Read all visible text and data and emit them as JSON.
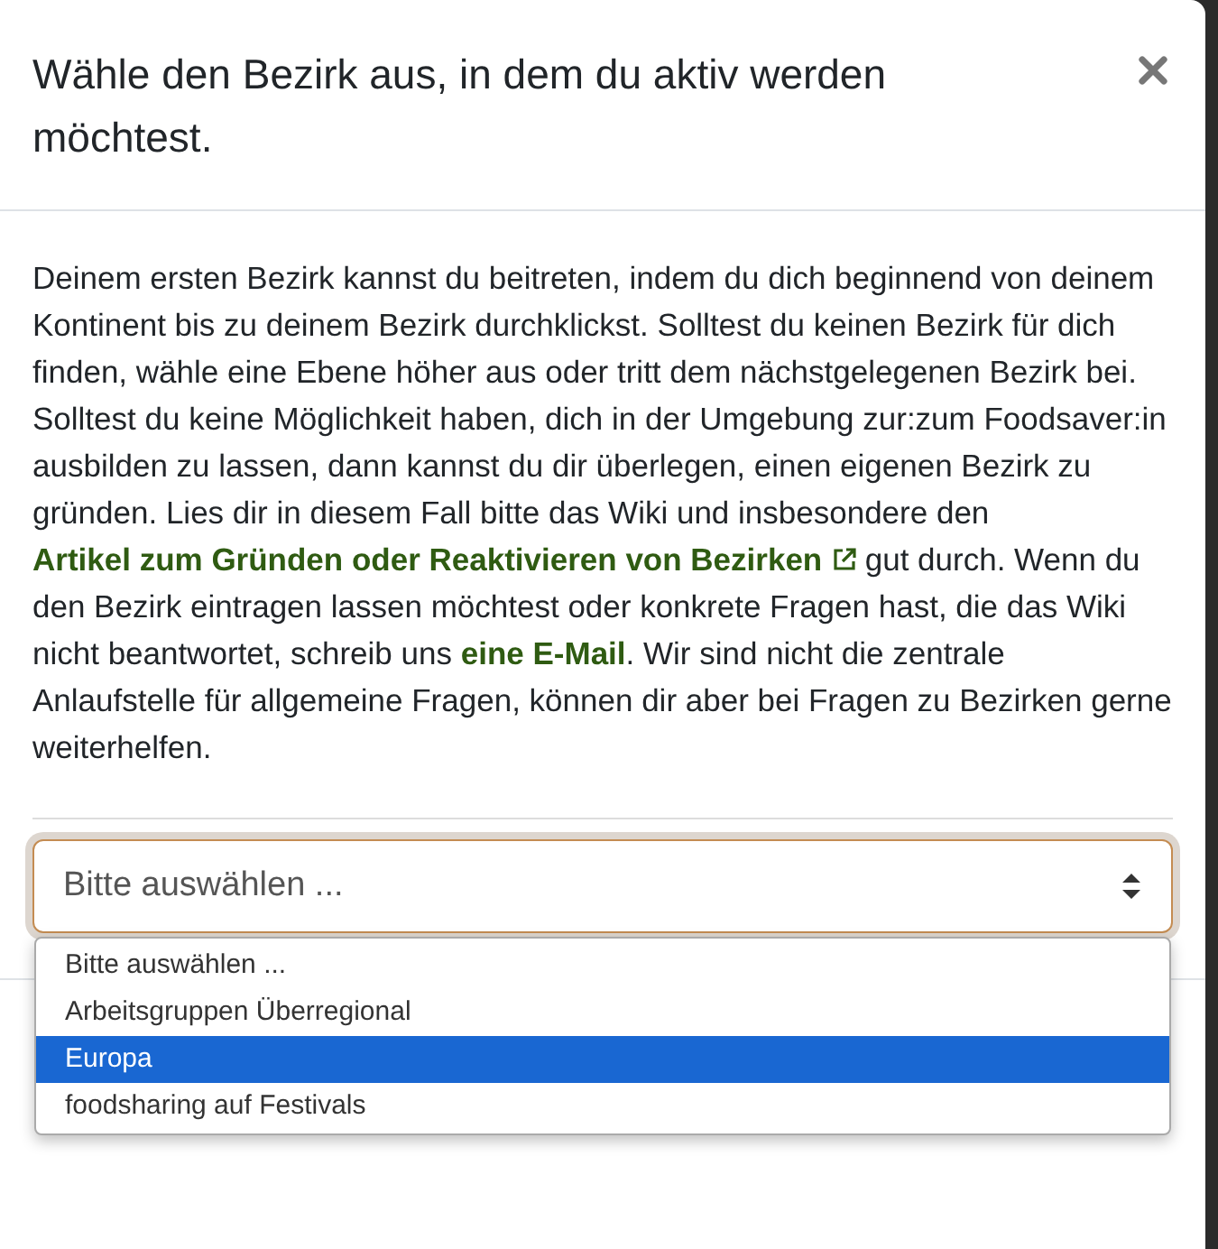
{
  "dialog": {
    "title": "Wähle den Bezirk aus, in dem du aktiv werden möchtest."
  },
  "description": [
    {
      "kind": "text",
      "text": "Deinem ersten Bezirk kannst du beitreten, indem du dich beginnend von deinem Kontinent bis zu deinem Bezirk durchklickst. Solltest du keinen Bezirk für dich finden, wähle eine Ebene höher aus oder tritt dem nächstgelegenen Bezirk bei. Solltest du keine Möglichkeit haben, dich in der Umgebung zur:zum Foodsaver:in ausbilden zu lassen, dann kannst du dir überlegen, einen eigenen Bezirk zu gründen. Lies dir in diesem Fall bitte das Wiki und insbesondere den "
    },
    {
      "kind": "link",
      "text": "Artikel zum Gründen oder Reaktivieren von Bezirken",
      "external": true
    },
    {
      "kind": "text",
      "text": " gut durch. Wenn du den Bezirk eintragen lassen möchtest oder konkrete Fragen hast, die das Wiki nicht beantwortet, schreib uns "
    },
    {
      "kind": "link",
      "text": "eine E-Mail",
      "external": false
    },
    {
      "kind": "text",
      "text": ". Wir sind nicht die zentrale Anlaufstelle für allgemeine Fragen, können dir aber bei Fragen zu Bezirken gerne weiterhelfen."
    }
  ],
  "select": {
    "value": "Bitte auswählen ...",
    "expanded": true,
    "options": [
      {
        "label": "Bitte auswählen ...",
        "highlighted": false
      },
      {
        "label": "Arbeitsgruppen Überregional",
        "highlighted": false
      },
      {
        "label": "Europa",
        "highlighted": true
      },
      {
        "label": "foodsharing auf Festivals",
        "highlighted": false
      }
    ]
  }
}
